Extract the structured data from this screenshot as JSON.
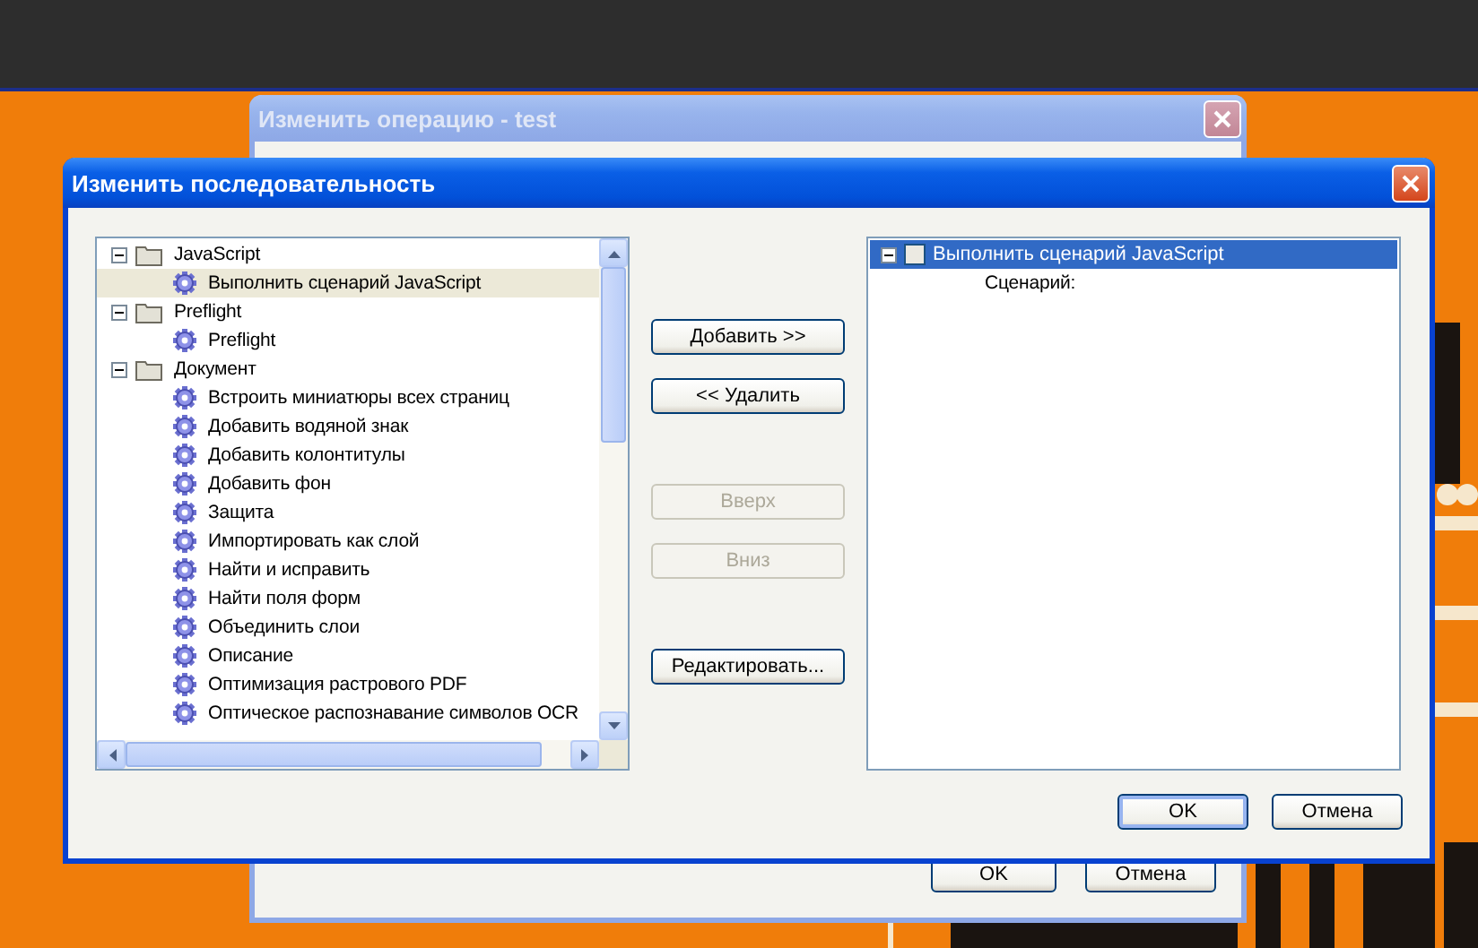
{
  "background_window": {
    "title": "Изменить операцию - test",
    "buttons": [
      {
        "label": "OK"
      },
      {
        "label": "Отмена"
      }
    ]
  },
  "dialog": {
    "title": "Изменить последовательность",
    "available": [
      {
        "label": "JavaScript",
        "expanded": true,
        "children": [
          {
            "label": "Выполнить сценарий JavaScript",
            "selected": true
          }
        ]
      },
      {
        "label": "Preflight",
        "expanded": true,
        "children": [
          {
            "label": "Preflight",
            "selected": false
          }
        ]
      },
      {
        "label": "Документ",
        "expanded": true,
        "children": [
          {
            "label": "Встроить миниатюры всех страниц",
            "selected": false
          },
          {
            "label": "Добавить водяной знак",
            "selected": false
          },
          {
            "label": "Добавить колонтитулы",
            "selected": false
          },
          {
            "label": "Добавить фон",
            "selected": false
          },
          {
            "label": "Защита",
            "selected": false
          },
          {
            "label": "Импортировать как слой",
            "selected": false
          },
          {
            "label": "Найти и исправить",
            "selected": false
          },
          {
            "label": "Найти поля форм",
            "selected": false
          },
          {
            "label": "Объединить слои",
            "selected": false
          },
          {
            "label": "Описание",
            "selected": false
          },
          {
            "label": "Оптимизация растрового PDF",
            "selected": false
          },
          {
            "label": "Оптическое распознавание символов OCR",
            "selected": false
          }
        ]
      }
    ],
    "actions": [
      {
        "label": "Добавить >>",
        "disabled": false
      },
      {
        "label": "<< Удалить",
        "disabled": false
      },
      {
        "label": "Вверх",
        "disabled": true
      },
      {
        "label": "Вниз",
        "disabled": true
      },
      {
        "label": "Редактировать...",
        "disabled": false
      }
    ],
    "sequence": [
      {
        "label": "Выполнить сценарий JavaScript",
        "selected": true,
        "checked": false,
        "expanded": true,
        "children": [
          {
            "label": "Сценарий:"
          }
        ]
      }
    ],
    "buttons": [
      {
        "label": "OK",
        "default": true
      },
      {
        "label": "Отмена",
        "default": false
      }
    ]
  }
}
